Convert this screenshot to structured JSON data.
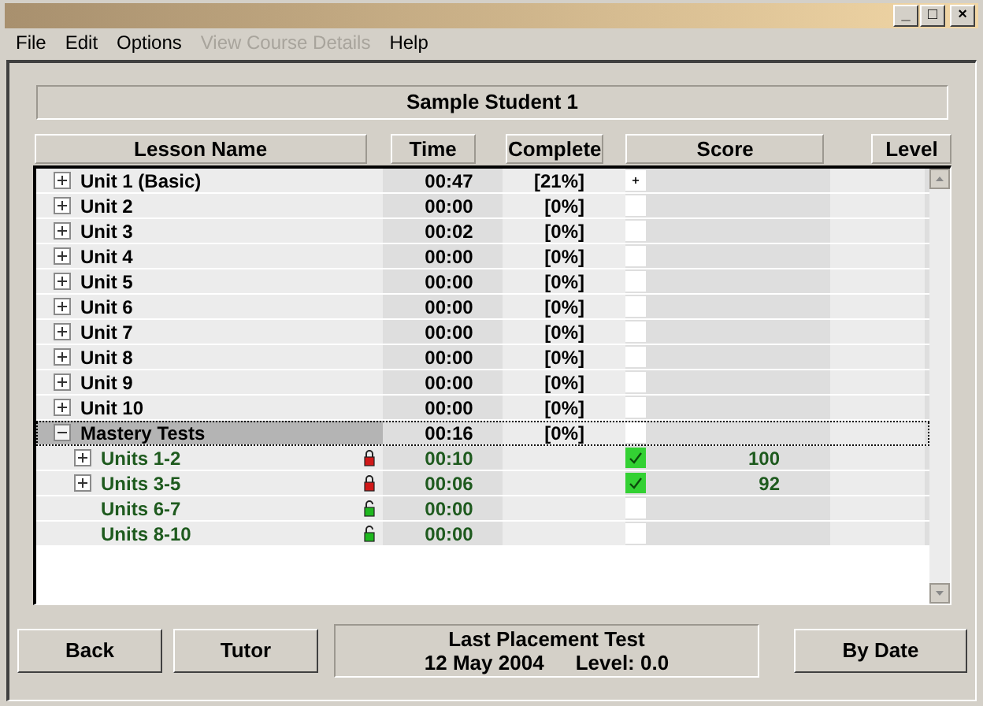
{
  "window": {
    "controls": [
      "_",
      "□",
      "×"
    ]
  },
  "menu": [
    {
      "label": "File",
      "disabled": false
    },
    {
      "label": "Edit",
      "disabled": false
    },
    {
      "label": "Options",
      "disabled": false
    },
    {
      "label": "View Course Details",
      "disabled": true
    },
    {
      "label": "Help",
      "disabled": false
    }
  ],
  "student": "Sample Student 1",
  "columns": [
    "Lesson Name",
    "Time",
    "Complete",
    "Score",
    "Level"
  ],
  "rows": [
    {
      "name": "Unit 1 (Basic)",
      "expandable": true,
      "expanded": false,
      "time": "00:47",
      "complete": "[21%]",
      "started": true,
      "passed": false,
      "selected": false
    },
    {
      "name": "Unit 2",
      "expandable": true,
      "expanded": false,
      "time": "00:00",
      "complete": "[0%]",
      "started": false,
      "passed": false,
      "selected": false
    },
    {
      "name": "Unit 3",
      "expandable": true,
      "expanded": false,
      "time": "00:02",
      "complete": "[0%]",
      "started": false,
      "passed": false,
      "selected": false
    },
    {
      "name": "Unit 4",
      "expandable": true,
      "expanded": false,
      "time": "00:00",
      "complete": "[0%]",
      "started": false,
      "passed": false,
      "selected": false
    },
    {
      "name": "Unit 5",
      "expandable": true,
      "expanded": false,
      "time": "00:00",
      "complete": "[0%]",
      "started": false,
      "passed": false,
      "selected": false
    },
    {
      "name": "Unit 6",
      "expandable": true,
      "expanded": false,
      "time": "00:00",
      "complete": "[0%]",
      "started": false,
      "passed": false,
      "selected": false
    },
    {
      "name": "Unit 7",
      "expandable": true,
      "expanded": false,
      "time": "00:00",
      "complete": "[0%]",
      "started": false,
      "passed": false,
      "selected": false
    },
    {
      "name": "Unit 8",
      "expandable": true,
      "expanded": false,
      "time": "00:00",
      "complete": "[0%]",
      "started": false,
      "passed": false,
      "selected": false
    },
    {
      "name": "Unit 9",
      "expandable": true,
      "expanded": false,
      "time": "00:00",
      "complete": "[0%]",
      "started": false,
      "passed": false,
      "selected": false
    },
    {
      "name": "Unit 10",
      "expandable": true,
      "expanded": false,
      "time": "00:00",
      "complete": "[0%]",
      "started": false,
      "passed": false,
      "selected": false
    },
    {
      "name": "Mastery Tests",
      "expandable": true,
      "expanded": true,
      "time": "00:16",
      "complete": "[0%]",
      "started": false,
      "passed": false,
      "selected": true,
      "children": [
        {
          "name": "Units 1-2",
          "expandable": true,
          "expanded": false,
          "locked": true,
          "time": "00:10",
          "started": true,
          "passed": true,
          "score": "100",
          "selected": false
        },
        {
          "name": "Units 3-5",
          "expandable": true,
          "expanded": false,
          "locked": true,
          "time": "00:06",
          "started": true,
          "passed": true,
          "score": "92",
          "selected": false
        },
        {
          "name": "Units 6-7",
          "expandable": false,
          "locked": false,
          "time": "00:00",
          "started": false,
          "passed": false,
          "selected": false
        },
        {
          "name": "Units 8-10",
          "expandable": false,
          "locked": false,
          "time": "00:00",
          "started": false,
          "passed": false,
          "selected": false
        }
      ]
    }
  ],
  "buttons_left": [
    "Back",
    "Tutor"
  ],
  "placement": {
    "title": "Last Placement Test",
    "date": "12 May 2004",
    "level": "Level: 0.0"
  },
  "buttons_right": [
    "By Date"
  ]
}
